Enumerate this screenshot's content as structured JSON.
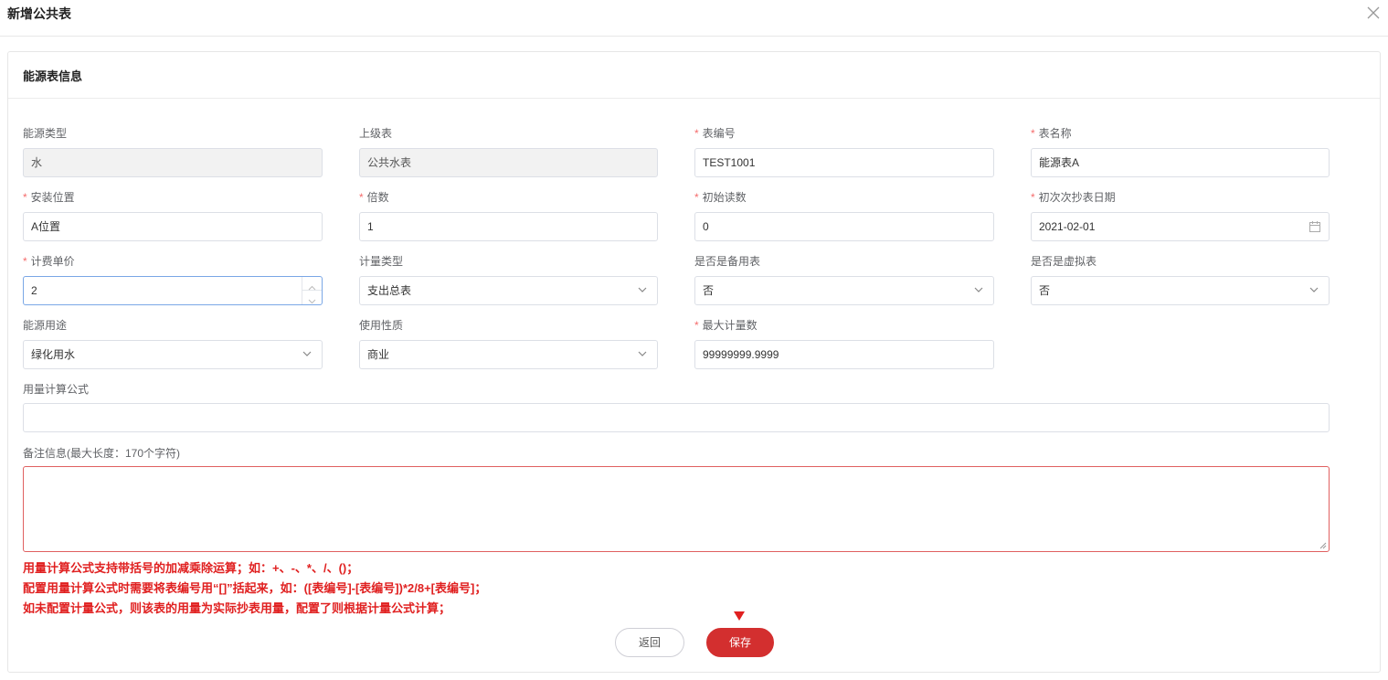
{
  "dialog": {
    "title": "新增公共表"
  },
  "section": {
    "title": "能源表信息"
  },
  "fields": {
    "energy_type": {
      "label": "能源类型",
      "value": "水",
      "required": false
    },
    "parent_meter": {
      "label": "上级表",
      "value": "公共水表",
      "required": false
    },
    "meter_no": {
      "label": "表编号",
      "value": "TEST1001",
      "required": true
    },
    "meter_name": {
      "label": "表名称",
      "value": "能源表A",
      "required": true
    },
    "install_location": {
      "label": "安装位置",
      "value": "A位置",
      "required": true
    },
    "multiplier": {
      "label": "倍数",
      "value": "1",
      "required": true
    },
    "initial_reading": {
      "label": "初始读数",
      "value": "0",
      "required": true
    },
    "first_read_date": {
      "label": "初次次抄表日期",
      "value": "2021-02-01",
      "required": true
    },
    "unit_price": {
      "label": "计费单价",
      "value": "2",
      "required": true
    },
    "metering_type": {
      "label": "计量类型",
      "value": "支出总表",
      "required": false
    },
    "is_backup": {
      "label": "是否是备用表",
      "value": "否",
      "required": false
    },
    "is_virtual": {
      "label": "是否是虚拟表",
      "value": "否",
      "required": false
    },
    "energy_usage": {
      "label": "能源用途",
      "value": "绿化用水",
      "required": false
    },
    "usage_nature": {
      "label": "使用性质",
      "value": "商业",
      "required": false
    },
    "max_count": {
      "label": "最大计量数",
      "value": "99999999.9999",
      "required": true
    },
    "formula": {
      "label": "用量计算公式",
      "value": ""
    },
    "remark": {
      "label": "备注信息(最大长度：170个字符)",
      "value": ""
    }
  },
  "notes": [
    "用量计算公式支持带括号的加减乘除运算；如：+、-、*、/、()；",
    "配置用量计算公式时需要将表编号用“[]”括起来，如：([表编号]-[表编号])*2/8+[表编号]；",
    "如未配置计量公式，则该表的用量为实际抄表用量，配置了则根据计量公式计算；"
  ],
  "buttons": {
    "back": "返回",
    "save": "保存"
  },
  "required_mark": "*",
  "colors": {
    "primary": "#d32f2f",
    "danger_text": "#e02020",
    "focus_border": "#7aa7e6"
  }
}
